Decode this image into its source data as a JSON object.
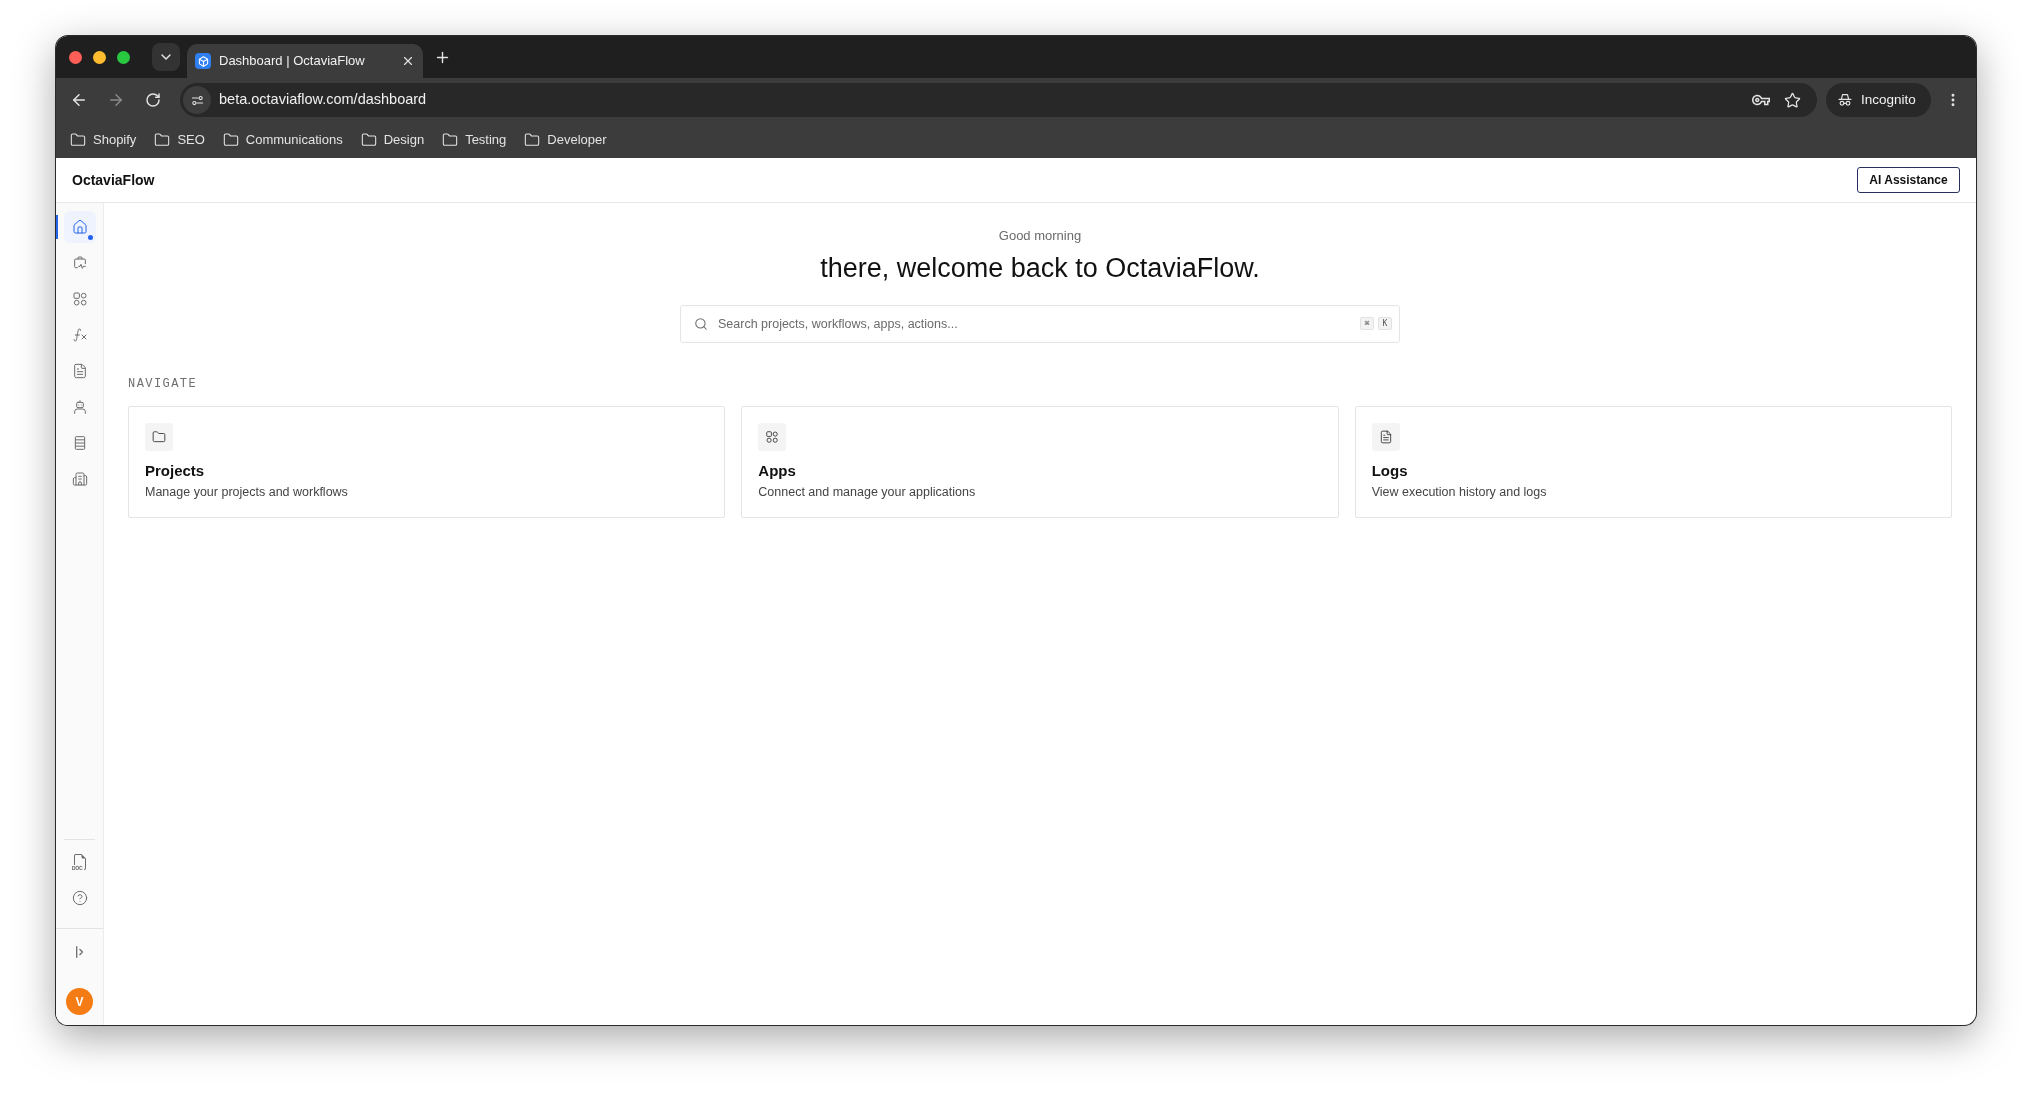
{
  "browser": {
    "tab": {
      "title": "Dashboard | OctaviaFlow",
      "selected": true
    },
    "url": "beta.octaviaflow.com/dashboard",
    "profile": "Incognito",
    "bookmarks": [
      "Shopify",
      "SEO",
      "Communications",
      "Design",
      "Testing",
      "Developer"
    ]
  },
  "header": {
    "brand": "OctaviaFlow",
    "button": "AI Assistance"
  },
  "sidebar": {
    "items": [
      {
        "selected": true
      },
      {
        "selected": false
      },
      {
        "selected": false
      },
      {
        "selected": false
      },
      {
        "selected": false
      },
      {
        "selected": false
      },
      {
        "selected": false
      },
      {
        "selected": false
      }
    ],
    "avatar": "V"
  },
  "greeting": "Good morning",
  "headline": "there, welcome back to OctaviaFlow.",
  "search": {
    "placeholder": "Search projects, workflows, apps, actions...",
    "shortcut": [
      "⌘",
      "K"
    ]
  },
  "navigate": {
    "heading": "NAVIGATE",
    "cards": [
      {
        "title": "Projects",
        "description": "Manage your projects and workflows"
      },
      {
        "title": "Apps",
        "description": "Connect and manage your applications"
      },
      {
        "title": "Logs",
        "description": "View execution history and logs"
      }
    ]
  }
}
